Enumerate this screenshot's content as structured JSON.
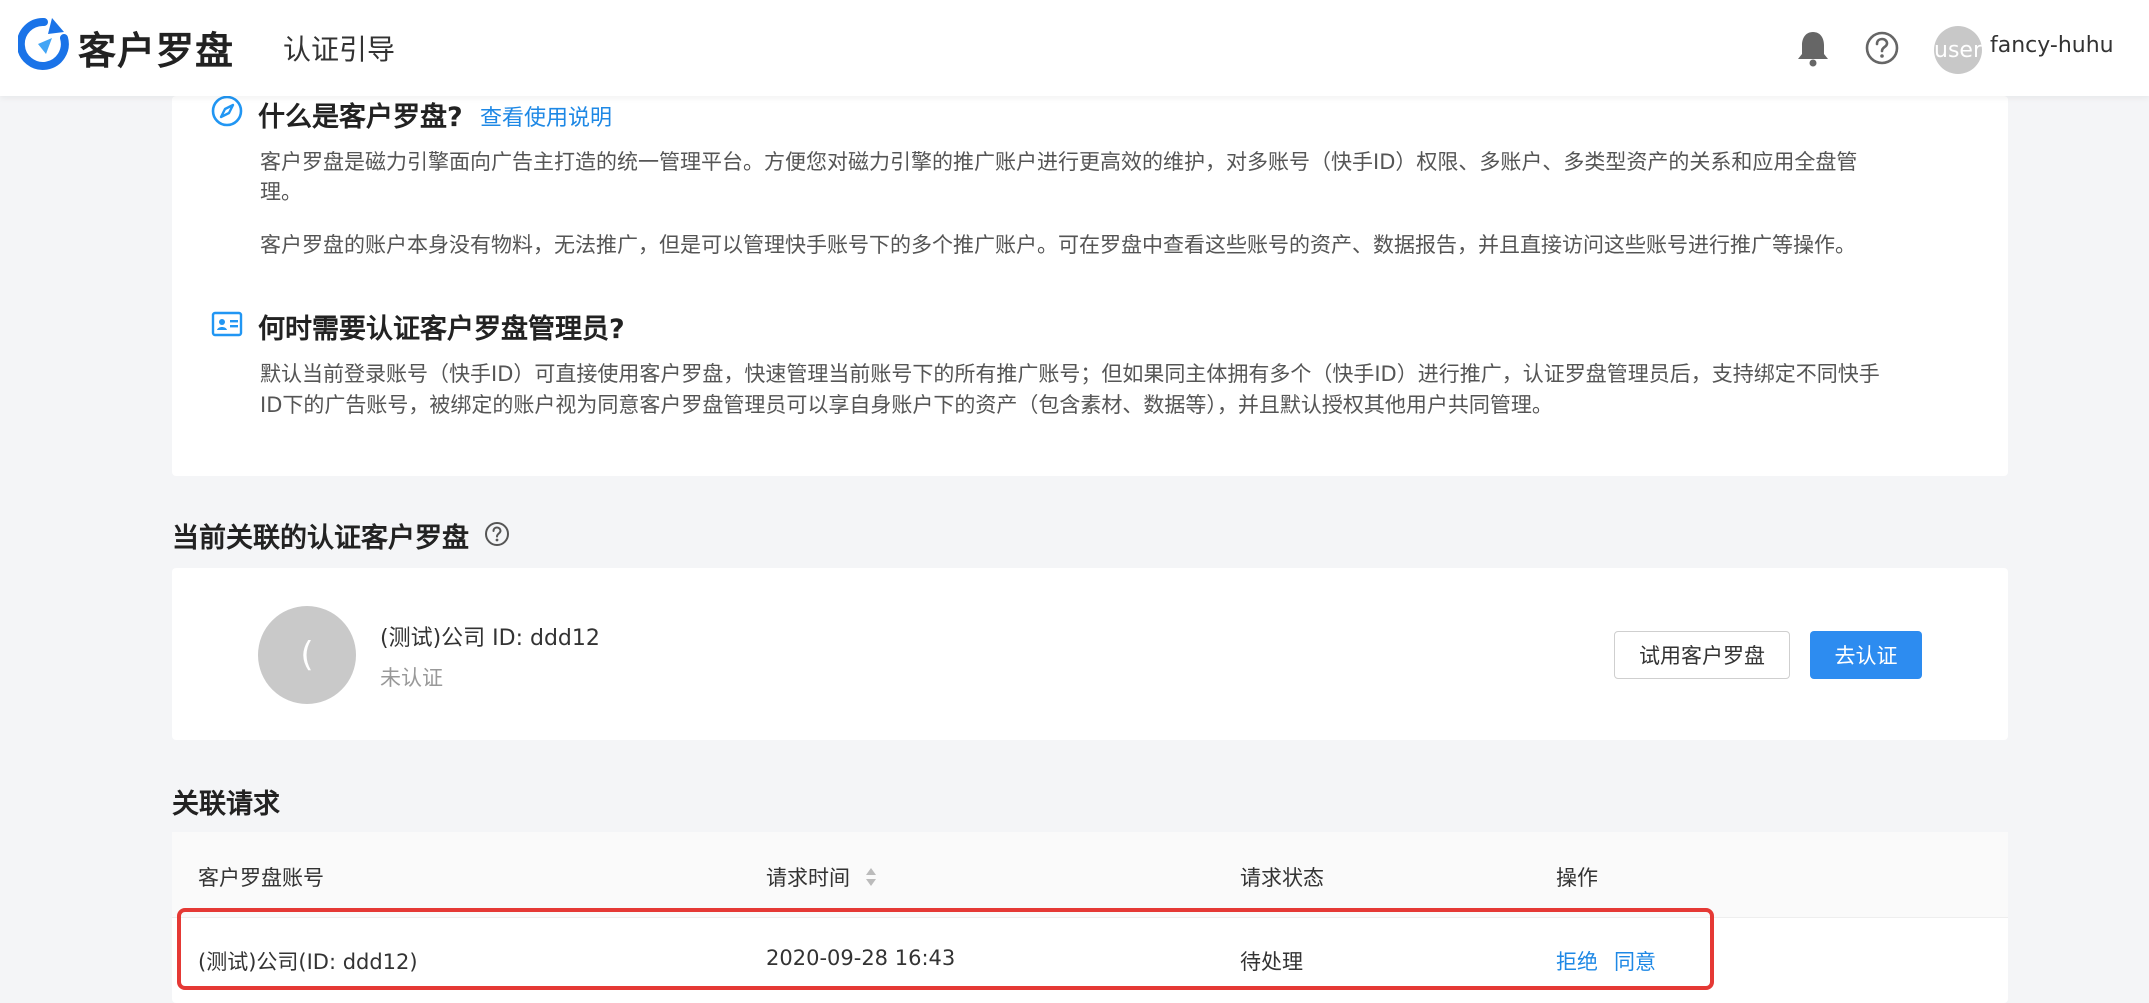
{
  "header": {
    "brand": "客户罗盘",
    "page_title": "认证引导",
    "avatar_text": "user",
    "username": "fancy-huhu"
  },
  "intro": {
    "what_title": "什么是客户罗盘?",
    "what_link": "查看使用说明",
    "what_para1_line1": "客户罗盘是磁力引擎面向广告主打造的统一管理平台。方便您对磁力引擎的推广账户进行更高效的维护，对多账号（快手ID）权限、多账户、多类型资产的关系和应用全盘管",
    "what_para1_line2": "理。",
    "what_para2": "客户罗盘的账户本身没有物料，无法推广，但是可以管理快手账号下的多个推广账户。可在罗盘中查看这些账号的资产、数据报告，并且直接访问这些账号进行推广等操作。",
    "when_title": "何时需要认证客户罗盘管理员?",
    "when_para_line1": "默认当前登录账号（快手ID）可直接使用客户罗盘，快速管理当前账号下的所有推广账号；但如果同主体拥有多个（快手ID）进行推广，认证罗盘管理员后，支持绑定不同快手",
    "when_para_line2": "ID下的广告账号，被绑定的账户视为同意客户罗盘管理员可以享自身账户下的资产（包含素材、数据等），并且默认授权其他用户共同管理。"
  },
  "linked": {
    "heading": "当前关联的认证客户罗盘",
    "avatar_text": "(",
    "company": "(测试)公司 ID: ddd12",
    "status": "未认证",
    "trial_button": "试用客户罗盘",
    "certify_button": "去认证"
  },
  "requests": {
    "heading": "关联请求",
    "columns": [
      "客户罗盘账号",
      "请求时间",
      "请求状态",
      "操作"
    ],
    "rows": [
      {
        "account": "(测试)公司(ID: ddd12)",
        "time": "2020-09-28 16:43",
        "status": "待处理",
        "reject": "拒绝",
        "approve": "同意"
      }
    ]
  },
  "colors": {
    "accent": "#1e88e5",
    "primary_button": "#2d8cf0",
    "highlight": "#e53935"
  }
}
